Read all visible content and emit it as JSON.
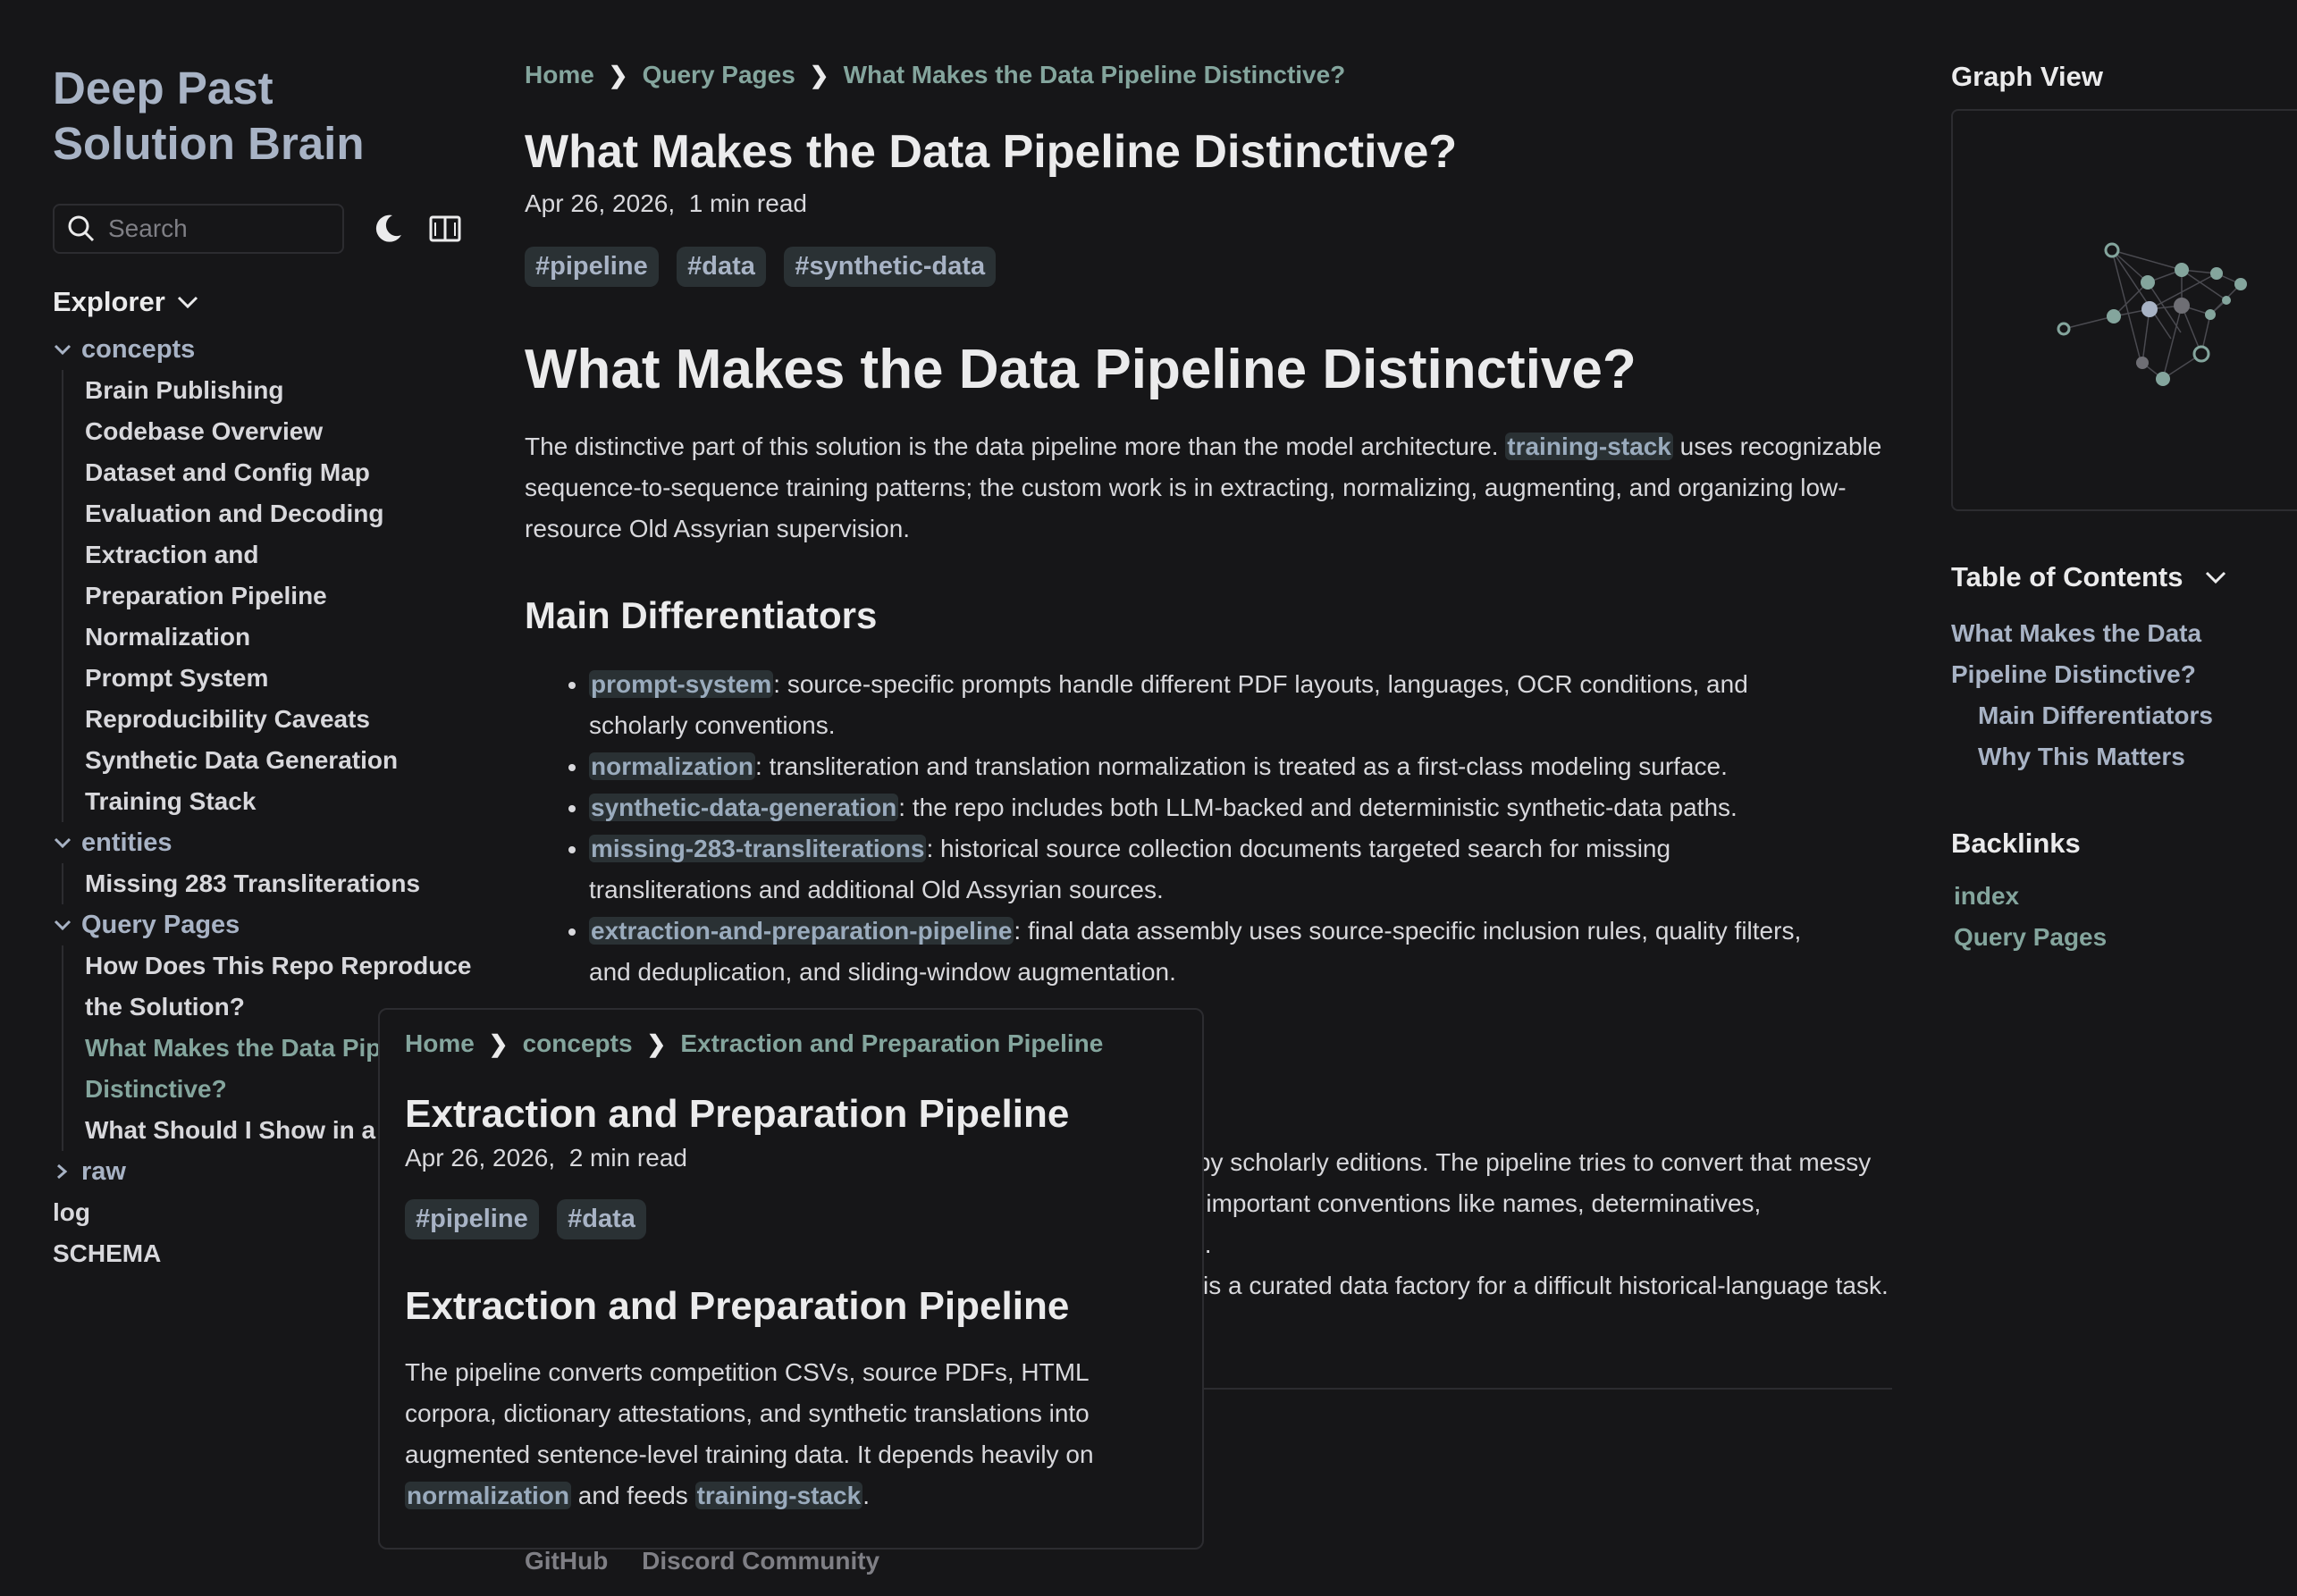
{
  "sidebar": {
    "site_title_line1": "Deep Past",
    "site_title_line2": "Solution Brain",
    "search_placeholder": "Search",
    "explorer_label": "Explorer",
    "concepts": {
      "label": "concepts",
      "items": [
        "Brain Publishing",
        "Codebase Overview",
        "Dataset and Config Map",
        "Evaluation and Decoding",
        "Extraction and",
        "Preparation Pipeline",
        "Normalization",
        "Prompt System",
        "Reproducibility Caveats",
        "Synthetic Data Generation",
        "Training Stack"
      ]
    },
    "entities": {
      "label": "entities",
      "items": [
        "Missing 283 Transliterations"
      ]
    },
    "query_pages": {
      "label": "Query Pages",
      "items": [
        "How Does This Repo Reproduce",
        "the Solution?",
        "What Makes the Data Pipeli",
        "Distinctive?",
        "What Should I Show in a De"
      ]
    },
    "raw_label": "raw",
    "log_label": "log",
    "schema_label": "SCHEMA"
  },
  "main": {
    "breadcrumb": [
      "Home",
      "Query Pages",
      "What Makes the Data Pipeline Distinctive?"
    ],
    "title": "What Makes the Data Pipeline Distinctive?",
    "date": "Apr 26, 2026,",
    "read_time": "1 min read",
    "tags": [
      "#pipeline",
      "#data",
      "#synthetic-data"
    ],
    "h1": "What Makes the Data Pipeline Distinctive?",
    "intro_pre": "The distinctive part of this solution is the data pipeline more than the model architecture.",
    "intro_link": "training-stack",
    "intro_post": "uses recognizable sequence-to-sequence training patterns; the custom work is in extracting, normalizing, augmenting, and organizing low-resource Old Assyrian supervision.",
    "h2": "Main Differentiators",
    "differentiators": [
      {
        "link": "prompt-system",
        "text": ": source-specific prompts handle different PDF layouts, languages, OCR conditions, and scholarly conventions."
      },
      {
        "link": "normalization",
        "text": ": transliteration and translation normalization is treated as a first-class modeling surface."
      },
      {
        "link": "synthetic-data-generation",
        "text": ": the repo includes both LLM-backed and deterministic synthetic-data paths."
      },
      {
        "link": "missing-283-transliterations",
        "text": ": historical source collection documents targeted search for missing transliterations and additional Old Assyrian sources."
      },
      {
        "link": "extraction-and-preparation-pipeline",
        "text": ": final data assembly uses source-specific inclusion rules, quality filters, and deduplication, and sliding-window augmentation."
      }
    ],
    "tail_line1": "ed by scholarly editions. The pipeline tries to convert that messy",
    "tail_line2": "ay important conventions like names, determinatives,",
    "tail_line3": "sts.",
    "tail_line4": "is a curated data factory for a difficult historical-language task.",
    "footer_links": [
      "GitHub",
      "Discord Community"
    ]
  },
  "right": {
    "graph_label": "Graph View",
    "toc_label": "Table of Contents",
    "toc_items": [
      {
        "text": "What Makes the Data",
        "sub": false
      },
      {
        "text": "Pipeline Distinctive?",
        "sub": false
      },
      {
        "text": "Main Differentiators",
        "sub": true
      },
      {
        "text": "Why This Matters",
        "sub": true
      }
    ],
    "backlinks_label": "Backlinks",
    "backlinks": [
      "index",
      "Query Pages"
    ]
  },
  "popover": {
    "breadcrumb": [
      "Home",
      "concepts",
      "Extraction and Preparation Pipeline"
    ],
    "title": "Extraction and Preparation Pipeline",
    "date": "Apr 26, 2026,",
    "read_time": "2 min read",
    "tags": [
      "#pipeline",
      "#data"
    ],
    "h1": "Extraction and Preparation Pipeline",
    "para_pre": "The pipeline converts competition CSVs, source PDFs, HTML corpora, dictionary attestations, and synthetic translations into augmented sentence-level training data. It depends heavily on",
    "para_link1": "normalization",
    "para_mid": "and feeds",
    "para_link2": "training-stack",
    "para_end": "."
  },
  "colors": {
    "background": "#161618",
    "accent": "#84a59d",
    "title": "#a8b3c5"
  }
}
